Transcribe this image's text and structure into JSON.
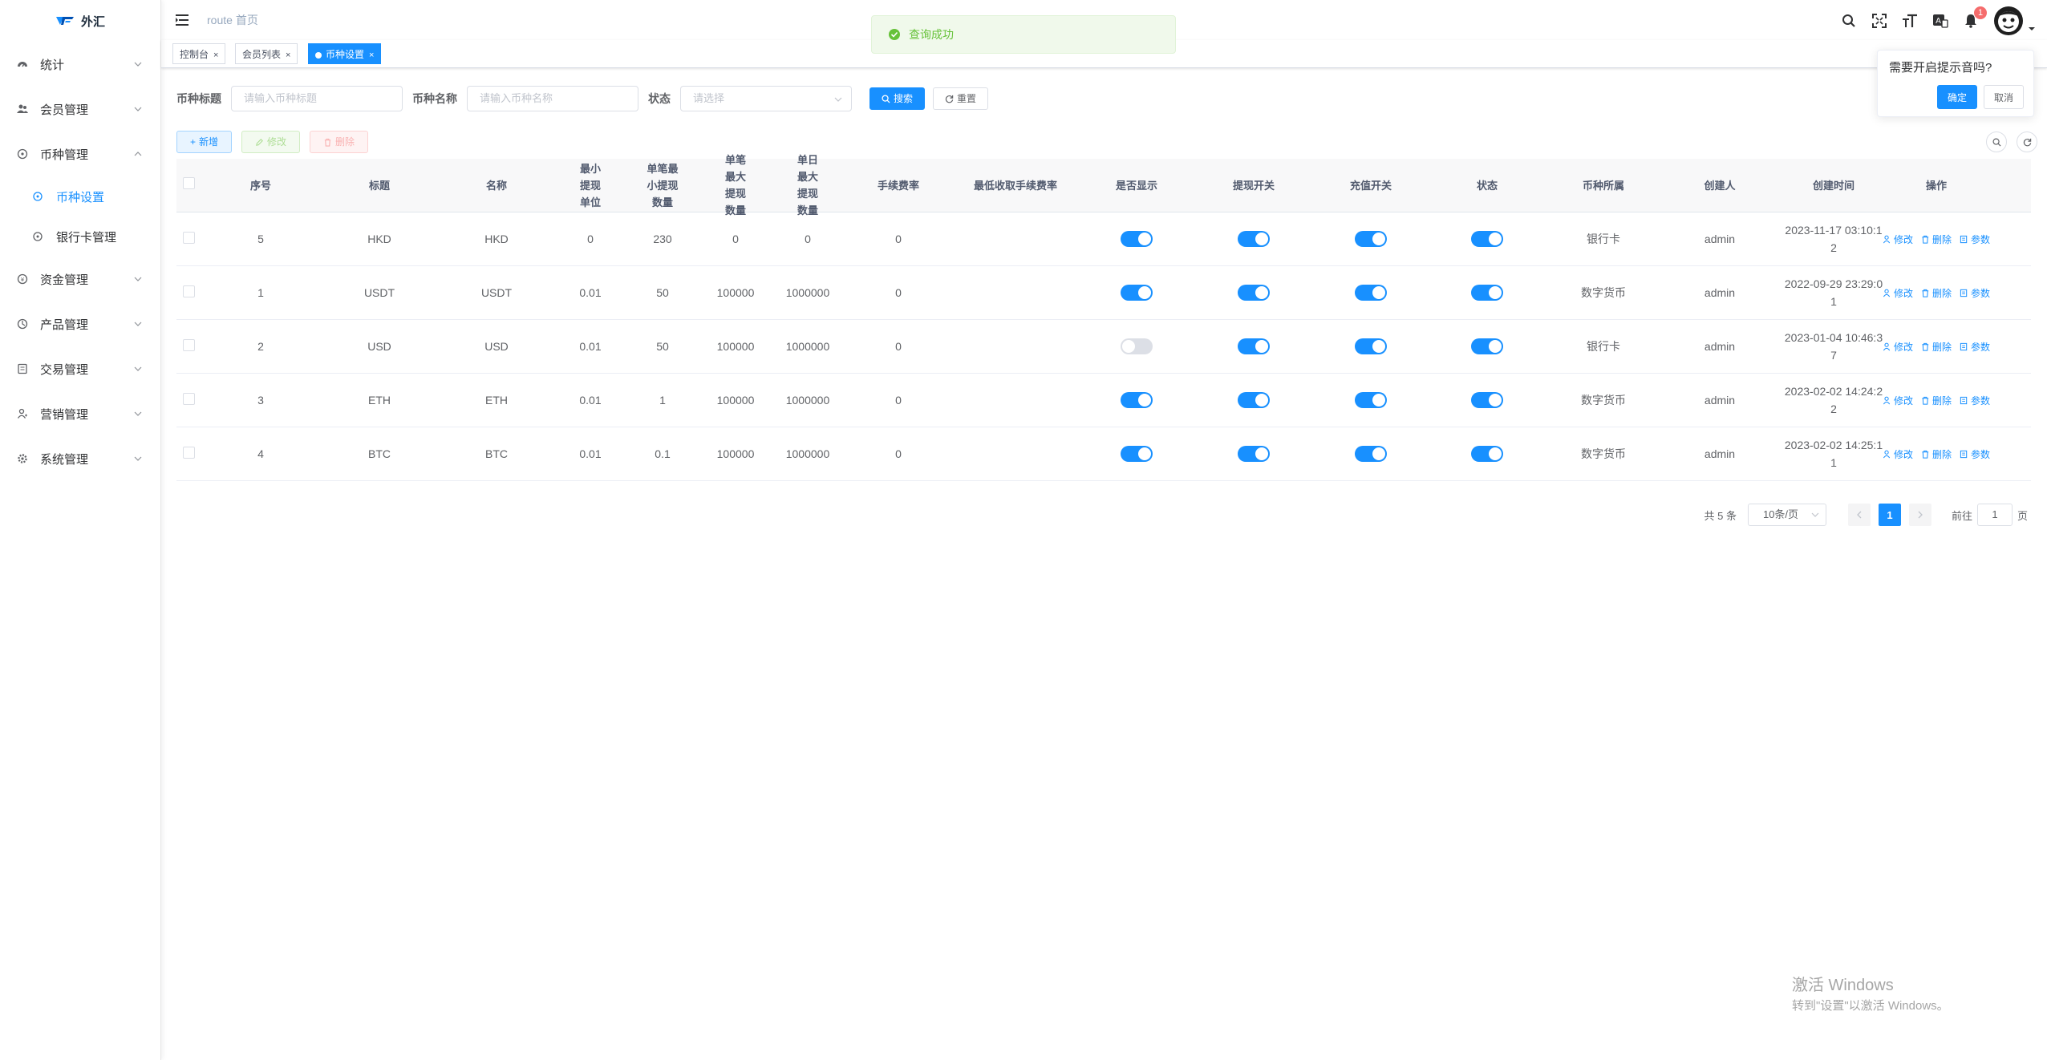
{
  "app": {
    "title": "外汇",
    "logo_icon": "forex-logo-icon"
  },
  "sidebar": {
    "items": [
      {
        "label": "统计",
        "icon": "dashboard-icon"
      },
      {
        "label": "会员管理",
        "icon": "users-icon"
      },
      {
        "label": "币种管理",
        "icon": "coin-icon",
        "expanded": true,
        "children": [
          {
            "label": "币种设置",
            "active": true
          },
          {
            "label": "银行卡管理"
          }
        ]
      },
      {
        "label": "资金管理",
        "icon": "money-icon"
      },
      {
        "label": "产品管理",
        "icon": "product-icon"
      },
      {
        "label": "交易管理",
        "icon": "trade-icon"
      },
      {
        "label": "营销管理",
        "icon": "marketing-icon"
      },
      {
        "label": "系统管理",
        "icon": "settings-icon"
      }
    ]
  },
  "header": {
    "breadcrumb": [
      "route",
      "首页"
    ],
    "notification_count": "1"
  },
  "tags": [
    {
      "label": "控制台"
    },
    {
      "label": "会员列表"
    },
    {
      "label": "币种设置",
      "active": true
    }
  ],
  "toast": {
    "message": "查询成功"
  },
  "popover": {
    "question": "需要开启提示音吗?",
    "confirm": "确定",
    "cancel": "取消"
  },
  "filters": {
    "title_label": "币种标题",
    "title_placeholder": "请输入币种标题",
    "name_label": "币种名称",
    "name_placeholder": "请输入币种名称",
    "status_label": "状态",
    "status_placeholder": "请选择",
    "search_button": "搜索",
    "reset_button": "重置"
  },
  "toolbar": {
    "add": "新增",
    "edit": "修改",
    "delete": "删除"
  },
  "table": {
    "columns": [
      {
        "key": "seq",
        "label": "序号"
      },
      {
        "key": "title",
        "label": "标题"
      },
      {
        "key": "name",
        "label": "名称"
      },
      {
        "key": "min_unit",
        "label": "最小提现单位"
      },
      {
        "key": "min_amount",
        "label": "单笔最小提现数量"
      },
      {
        "key": "max_amount",
        "label": "单笔最大提现数量"
      },
      {
        "key": "daily_max",
        "label": "单日最大提现数量"
      },
      {
        "key": "fee_rate",
        "label": "手续费率"
      },
      {
        "key": "min_fee",
        "label": "最低收取手续费率"
      },
      {
        "key": "show",
        "label": "是否显示"
      },
      {
        "key": "withdraw",
        "label": "提现开关"
      },
      {
        "key": "deposit",
        "label": "充值开关"
      },
      {
        "key": "status",
        "label": "状态"
      },
      {
        "key": "category",
        "label": "币种所属"
      },
      {
        "key": "creator",
        "label": "创建人"
      },
      {
        "key": "created",
        "label": "创建时间"
      },
      {
        "key": "ops",
        "label": "操作"
      }
    ],
    "rows": [
      {
        "seq": "5",
        "title": "HKD",
        "name": "HKD",
        "min_unit": "0",
        "min_amount": "230",
        "max_amount": "0",
        "daily_max": "0",
        "fee_rate": "0",
        "min_fee": "",
        "show": true,
        "withdraw": true,
        "deposit": true,
        "status": true,
        "category": "银行卡",
        "creator": "admin",
        "created_1": "2023-11-17 03:10:1",
        "created_2": "2"
      },
      {
        "seq": "1",
        "title": "USDT",
        "name": "USDT",
        "min_unit": "0.01",
        "min_amount": "50",
        "max_amount": "100000",
        "daily_max": "1000000",
        "fee_rate": "0",
        "min_fee": "",
        "show": true,
        "withdraw": true,
        "deposit": true,
        "status": true,
        "category": "数字货币",
        "creator": "admin",
        "created_1": "2022-09-29 23:29:0",
        "created_2": "1"
      },
      {
        "seq": "2",
        "title": "USD",
        "name": "USD",
        "min_unit": "0.01",
        "min_amount": "50",
        "max_amount": "100000",
        "daily_max": "1000000",
        "fee_rate": "0",
        "min_fee": "",
        "show": false,
        "withdraw": true,
        "deposit": true,
        "status": true,
        "category": "银行卡",
        "creator": "admin",
        "created_1": "2023-01-04 10:46:3",
        "created_2": "7"
      },
      {
        "seq": "3",
        "title": "ETH",
        "name": "ETH",
        "min_unit": "0.01",
        "min_amount": "1",
        "max_amount": "100000",
        "daily_max": "1000000",
        "fee_rate": "0",
        "min_fee": "",
        "show": true,
        "withdraw": true,
        "deposit": true,
        "status": true,
        "category": "数字货币",
        "creator": "admin",
        "created_1": "2023-02-02 14:24:2",
        "created_2": "2"
      },
      {
        "seq": "4",
        "title": "BTC",
        "name": "BTC",
        "min_unit": "0.01",
        "min_amount": "0.1",
        "max_amount": "100000",
        "daily_max": "1000000",
        "fee_rate": "0",
        "min_fee": "",
        "show": true,
        "withdraw": true,
        "deposit": true,
        "status": true,
        "category": "数字货币",
        "creator": "admin",
        "created_1": "2023-02-02 14:25:1",
        "created_2": "1"
      }
    ],
    "row_ops": {
      "edit": "修改",
      "delete": "删除",
      "params": "参数"
    }
  },
  "pagination": {
    "total": "共 5 条",
    "page_size": "10条/页",
    "current_page": "1",
    "goto_prefix": "前往",
    "goto_value": "1",
    "goto_suffix": "页"
  },
  "watermark": {
    "line1": "激活 Windows",
    "line2": "转到\"设置\"以激活 Windows。"
  },
  "colors": {
    "primary": "#1890ff",
    "success": "#67c23a",
    "danger": "#f56c6c"
  }
}
